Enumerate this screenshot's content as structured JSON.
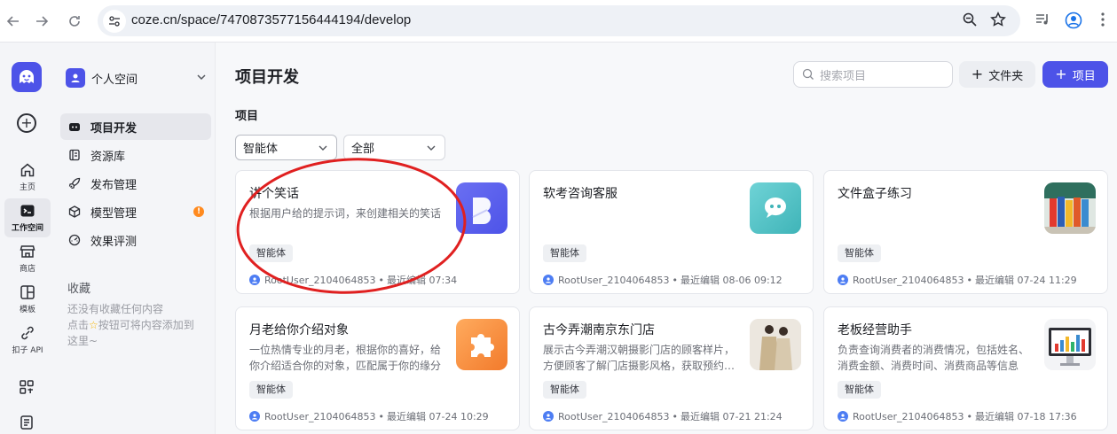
{
  "browser": {
    "url": "coze.cn/space/7470873577156444194/develop"
  },
  "rail": {
    "items": [
      {
        "label": "主页",
        "icon": "home-icon"
      },
      {
        "label": "工作空间",
        "icon": "terminal-icon",
        "active": true
      },
      {
        "label": "商店",
        "icon": "store-icon"
      },
      {
        "label": "模板",
        "icon": "template-icon"
      },
      {
        "label": "扣子 API",
        "icon": "api-icon"
      }
    ]
  },
  "sidebar": {
    "space_name": "个人空间",
    "menu": [
      {
        "label": "项目开发",
        "icon": "bot-icon",
        "active": true
      },
      {
        "label": "资源库",
        "icon": "library-icon"
      },
      {
        "label": "发布管理",
        "icon": "rocket-icon"
      },
      {
        "label": "模型管理",
        "icon": "cube-icon",
        "badge": "!"
      },
      {
        "label": "效果评测",
        "icon": "gauge-icon"
      }
    ],
    "favorites_title": "收藏",
    "favorites_empty_line1": "还没有收藏任何内容",
    "favorites_empty_line2_a": "点击",
    "favorites_empty_line2_b": "按钮可将内容添加到",
    "favorites_empty_line3": "这里~"
  },
  "main": {
    "title": "项目开发",
    "search_placeholder": "搜索项目",
    "folder_button": "文件夹",
    "project_button": "项目",
    "section_label": "项目",
    "filter_type": "智能体",
    "filter_status": "全部",
    "cards": [
      {
        "title": "讲个笑话",
        "desc": "根据用户给的提示词，来创建相关的笑话",
        "tag": "智能体",
        "user": "RootUser_2104064853",
        "edited": "最近编辑 07:34",
        "image": "purple-logo"
      },
      {
        "title": "软考咨询客服",
        "desc": "",
        "tag": "智能体",
        "user": "RootUser_2104064853",
        "edited": "最近编辑 08-06 09:12",
        "image": "teal-chat"
      },
      {
        "title": "文件盒子练习",
        "desc": "",
        "tag": "智能体",
        "user": "RootUser_2104064853",
        "edited": "最近编辑 07-24 11:29",
        "image": "binders"
      },
      {
        "title": "月老给你介绍对象",
        "desc": "一位热情专业的月老，根据你的喜好，给你介绍适合你的对象，匹配属于你的缘分",
        "tag": "智能体",
        "user": "RootUser_2104064853",
        "edited": "最近编辑 07-24 10:29",
        "image": "orange-puzzle"
      },
      {
        "title": "古今弄潮南京东门店",
        "desc": "展示古今弄潮汉朝摄影门店的顾客样片，方便顾客了解门店摄影风格，获取预约信息",
        "tag": "智能体",
        "user": "RootUser_2104064853",
        "edited": "最近编辑 07-21 21:24",
        "image": "hanfu-photo"
      },
      {
        "title": "老板经营助手",
        "desc": "负责查询消费者的消费情况，包括姓名、消费金额、消费时间、消费商品等信息",
        "tag": "智能体",
        "user": "RootUser_2104064853",
        "edited": "最近编辑 07-18 17:36",
        "image": "monitor-chart"
      }
    ]
  },
  "colors": {
    "brand": "#4d53e8",
    "annotation": "#e02020",
    "badge": "#ff8a1f"
  }
}
